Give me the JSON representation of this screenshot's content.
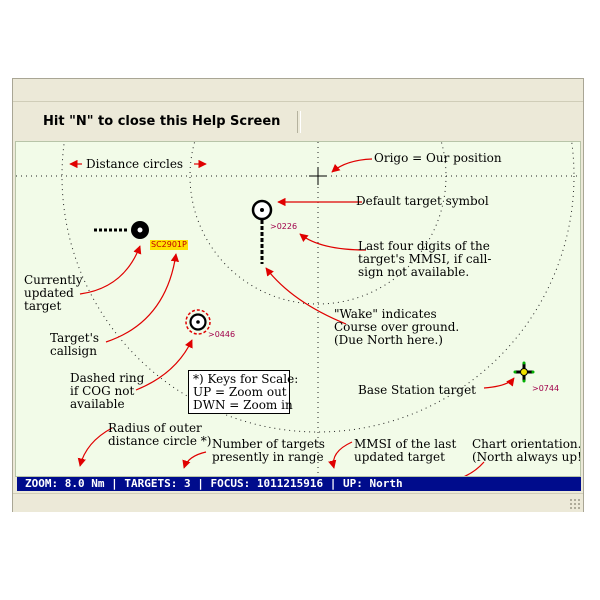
{
  "toolbar": {
    "help_hint": "Hit \"N\" to close this Help Screen"
  },
  "chart": {
    "annotations": {
      "distance_circles": "Distance circles",
      "origo": "Origo = Our position",
      "default_symbol": "Default target symbol",
      "last_four": [
        "Last four digits of the",
        "target's MMSI, if call-",
        "sign not available."
      ],
      "wake": [
        "\"Wake\" indicates",
        "Course over ground.",
        "(Due North here.)"
      ],
      "currently_updated": [
        "Currently",
        "updated",
        "target"
      ],
      "callsign_note": [
        "Target's",
        "callsign"
      ],
      "dashed_ring": [
        "Dashed ring",
        "if COG not",
        "available"
      ],
      "base_station": "Base Station target",
      "radius_outer": [
        "Radius of outer",
        "distance circle *)"
      ],
      "num_targets": [
        "Number of targets",
        "presently in range"
      ],
      "mmsi_last": [
        "MMSI of the last",
        "updated target"
      ],
      "chart_orientation": [
        "Chart orientation.",
        "(North always up!)"
      ]
    },
    "keys_box": [
      "*) Keys for Scale:",
      "UP = Zoom out",
      "DWN = Zoom in"
    ],
    "targets": {
      "callsign": "SC2901P",
      "mmsi_default": ">0226",
      "mmsi_dashed": ">0446",
      "mmsi_base": ">0744"
    }
  },
  "statusbar": {
    "zoom_label": "ZOOM:",
    "zoom_value": "8.0 Nm",
    "targets_label": "TARGETS:",
    "targets_value": "3",
    "focus_label": "FOCUS:",
    "focus_value": "1011215916",
    "up_label": "UP:",
    "up_value": "North"
  },
  "colors": {
    "chart_bg": "#f2fbe8",
    "statusbar_bg": "#000c8c",
    "annotation_arrow": "#e00000",
    "window_bg": "#ece9d8"
  },
  "icons": [
    "origo-crosshair-icon",
    "target-symbol-icon",
    "base-station-icon",
    "resize-grip-icon"
  ]
}
